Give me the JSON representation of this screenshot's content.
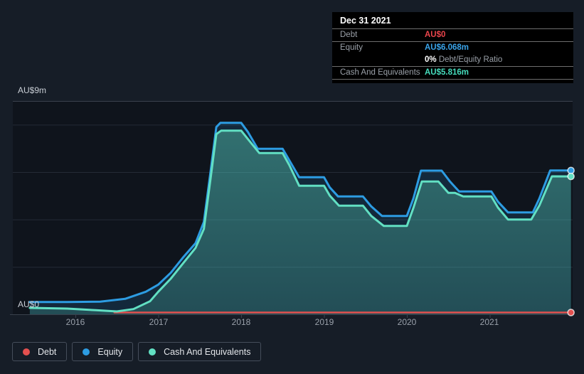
{
  "tooltip": {
    "date": "Dec 31 2021",
    "ratio_bold": "0%",
    "ratio_text": "Debt/Equity Ratio",
    "rows": [
      {
        "label": "Debt",
        "value": "AU$0",
        "color": "#ea454c"
      },
      {
        "label": "Equity",
        "value": "AU$6.068m",
        "color": "#3aa4ea"
      },
      {
        "label": "Cash And Equivalents",
        "value": "AU$5.816m",
        "color": "#46ddbd"
      }
    ]
  },
  "axis": {
    "y_top_label": "AU$9m",
    "y_bottom_label": "AU$0",
    "x_ticks": [
      "2016",
      "2017",
      "2018",
      "2019",
      "2020",
      "2021"
    ]
  },
  "legend": [
    {
      "label": "Debt",
      "color": "#e3504f"
    },
    {
      "label": "Equity",
      "color": "#2d9ce2"
    },
    {
      "label": "Cash And Equivalents",
      "color": "#62e0c3"
    }
  ],
  "chart_data": {
    "type": "area",
    "title": "",
    "x_unit": "decimal_year",
    "x_range": [
      2015.45,
      2021.98
    ],
    "ylim": [
      0,
      9
    ],
    "y_unit": "AU$ millions",
    "y_gridlines": [
      2,
      4,
      6,
      8
    ],
    "grid": true,
    "legend_position": "bottom-left",
    "series": [
      {
        "name": "Debt",
        "color": "#e3504f",
        "fill": false,
        "points": [
          [
            2016.47,
            0
          ],
          [
            2021.98,
            0
          ]
        ]
      },
      {
        "name": "Equity",
        "color": "#2d9ce2",
        "fill": true,
        "fill_color": "rgba(45,156,226,0.16)",
        "points": [
          [
            2015.45,
            0.52
          ],
          [
            2015.9,
            0.52
          ],
          [
            2016.3,
            0.53
          ],
          [
            2016.6,
            0.65
          ],
          [
            2016.85,
            0.95
          ],
          [
            2017.0,
            1.25
          ],
          [
            2017.15,
            1.75
          ],
          [
            2017.3,
            2.4
          ],
          [
            2017.45,
            3.0
          ],
          [
            2017.55,
            3.9
          ],
          [
            2017.63,
            6.0
          ],
          [
            2017.7,
            7.9
          ],
          [
            2017.75,
            8.08
          ],
          [
            2018.0,
            8.08
          ],
          [
            2018.08,
            7.7
          ],
          [
            2018.2,
            6.98
          ],
          [
            2018.5,
            6.98
          ],
          [
            2018.58,
            6.5
          ],
          [
            2018.7,
            5.78
          ],
          [
            2019.0,
            5.78
          ],
          [
            2019.07,
            5.35
          ],
          [
            2019.17,
            4.97
          ],
          [
            2019.47,
            4.97
          ],
          [
            2019.57,
            4.55
          ],
          [
            2019.7,
            4.15
          ],
          [
            2020.0,
            4.15
          ],
          [
            2020.08,
            4.9
          ],
          [
            2020.17,
            6.06
          ],
          [
            2020.42,
            6.06
          ],
          [
            2020.52,
            5.6
          ],
          [
            2020.63,
            5.18
          ],
          [
            2021.02,
            5.18
          ],
          [
            2021.1,
            4.75
          ],
          [
            2021.22,
            4.3
          ],
          [
            2021.52,
            4.3
          ],
          [
            2021.6,
            4.9
          ],
          [
            2021.73,
            6.07
          ],
          [
            2021.98,
            6.068
          ]
        ]
      },
      {
        "name": "Cash And Equivalents",
        "color": "#62e0c3",
        "fill": true,
        "fill_gradient": [
          "rgba(98,224,195,0.42)",
          "rgba(98,224,195,0.20)"
        ],
        "points": [
          [
            2015.45,
            0.27
          ],
          [
            2015.9,
            0.24
          ],
          [
            2016.25,
            0.17
          ],
          [
            2016.5,
            0.12
          ],
          [
            2016.7,
            0.22
          ],
          [
            2016.9,
            0.55
          ],
          [
            2017.0,
            0.95
          ],
          [
            2017.15,
            1.5
          ],
          [
            2017.3,
            2.15
          ],
          [
            2017.45,
            2.8
          ],
          [
            2017.55,
            3.6
          ],
          [
            2017.63,
            5.7
          ],
          [
            2017.7,
            7.6
          ],
          [
            2017.76,
            7.75
          ],
          [
            2018.0,
            7.75
          ],
          [
            2018.08,
            7.4
          ],
          [
            2018.22,
            6.8
          ],
          [
            2018.5,
            6.8
          ],
          [
            2018.58,
            6.3
          ],
          [
            2018.7,
            5.42
          ],
          [
            2019.0,
            5.42
          ],
          [
            2019.07,
            5.0
          ],
          [
            2019.18,
            4.58
          ],
          [
            2019.47,
            4.58
          ],
          [
            2019.57,
            4.15
          ],
          [
            2019.72,
            3.73
          ],
          [
            2020.0,
            3.73
          ],
          [
            2020.08,
            4.5
          ],
          [
            2020.18,
            5.6
          ],
          [
            2020.38,
            5.6
          ],
          [
            2020.5,
            5.12
          ],
          [
            2020.58,
            5.12
          ],
          [
            2020.68,
            4.97
          ],
          [
            2021.02,
            4.97
          ],
          [
            2021.1,
            4.5
          ],
          [
            2021.22,
            4.0
          ],
          [
            2021.5,
            4.0
          ],
          [
            2021.6,
            4.6
          ],
          [
            2021.75,
            5.82
          ],
          [
            2021.98,
            5.816
          ]
        ]
      }
    ],
    "end_markers": [
      {
        "series": "Equity",
        "x": 2021.98,
        "y": 6.068
      },
      {
        "series": "Cash And Equivalents",
        "x": 2021.98,
        "y": 5.816
      },
      {
        "series": "Debt",
        "x": 2021.98,
        "y": 0
      }
    ]
  }
}
